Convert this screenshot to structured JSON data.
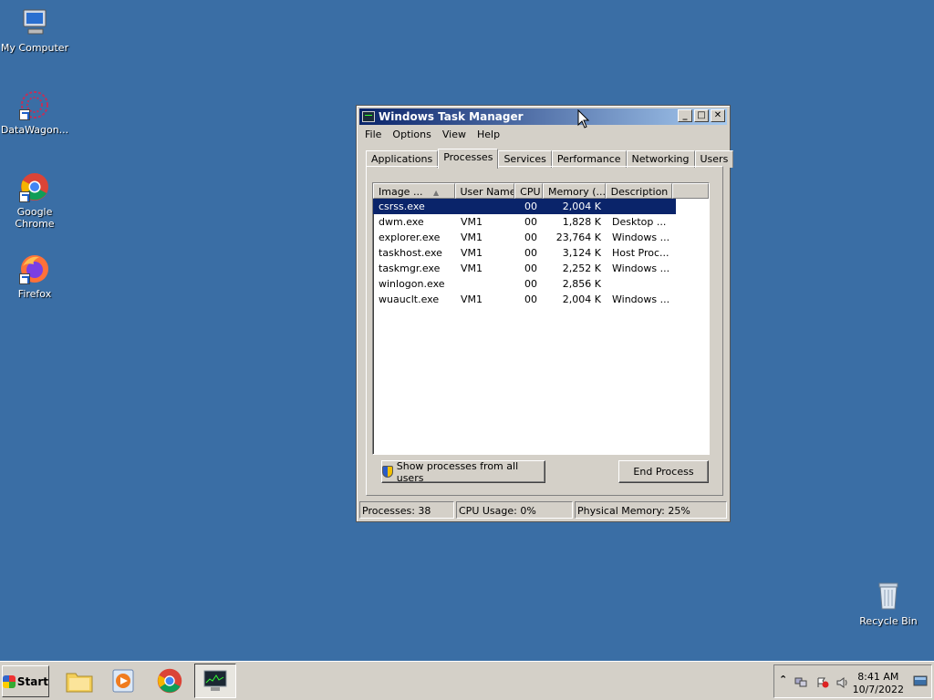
{
  "desktop": {
    "icons": [
      {
        "label": "My Computer"
      },
      {
        "label": "DataWagon..."
      },
      {
        "label": "Google Chrome"
      },
      {
        "label": "Firefox"
      },
      {
        "label": "Recycle Bin"
      }
    ]
  },
  "window": {
    "title": "Windows Task Manager",
    "controls": {
      "minimize": "_",
      "maximize": "□",
      "close": "✕"
    },
    "menu": [
      "File",
      "Options",
      "View",
      "Help"
    ],
    "tabs": [
      "Applications",
      "Processes",
      "Services",
      "Performance",
      "Networking",
      "Users"
    ],
    "active_tab": "Processes",
    "columns": [
      "Image ...",
      "User Name",
      "CPU",
      "Memory (...",
      "Description"
    ],
    "sort_arrow": "▲",
    "processes": [
      {
        "image": "csrss.exe",
        "user": "",
        "cpu": "00",
        "memory": "2,004 K",
        "description": "",
        "selected": true
      },
      {
        "image": "dwm.exe",
        "user": "VM1",
        "cpu": "00",
        "memory": "1,828 K",
        "description": "Desktop ..."
      },
      {
        "image": "explorer.exe",
        "user": "VM1",
        "cpu": "00",
        "memory": "23,764 K",
        "description": "Windows ..."
      },
      {
        "image": "taskhost.exe",
        "user": "VM1",
        "cpu": "00",
        "memory": "3,124 K",
        "description": "Host Proc..."
      },
      {
        "image": "taskmgr.exe",
        "user": "VM1",
        "cpu": "00",
        "memory": "2,252 K",
        "description": "Windows ..."
      },
      {
        "image": "winlogon.exe",
        "user": "",
        "cpu": "00",
        "memory": "2,856 K",
        "description": ""
      },
      {
        "image": "wuauclt.exe",
        "user": "VM1",
        "cpu": "00",
        "memory": "2,004 K",
        "description": "Windows ..."
      }
    ],
    "show_all_label": "Show processes from all users",
    "end_process_label": "End Process",
    "status": {
      "processes": "Processes: 38",
      "cpu": "CPU Usage: 0%",
      "memory": "Physical Memory: 25%"
    }
  },
  "taskbar": {
    "start_label": "Start",
    "clock_time": "8:41 AM",
    "clock_date": "10/7/2022",
    "tray_expand": "⌃"
  }
}
